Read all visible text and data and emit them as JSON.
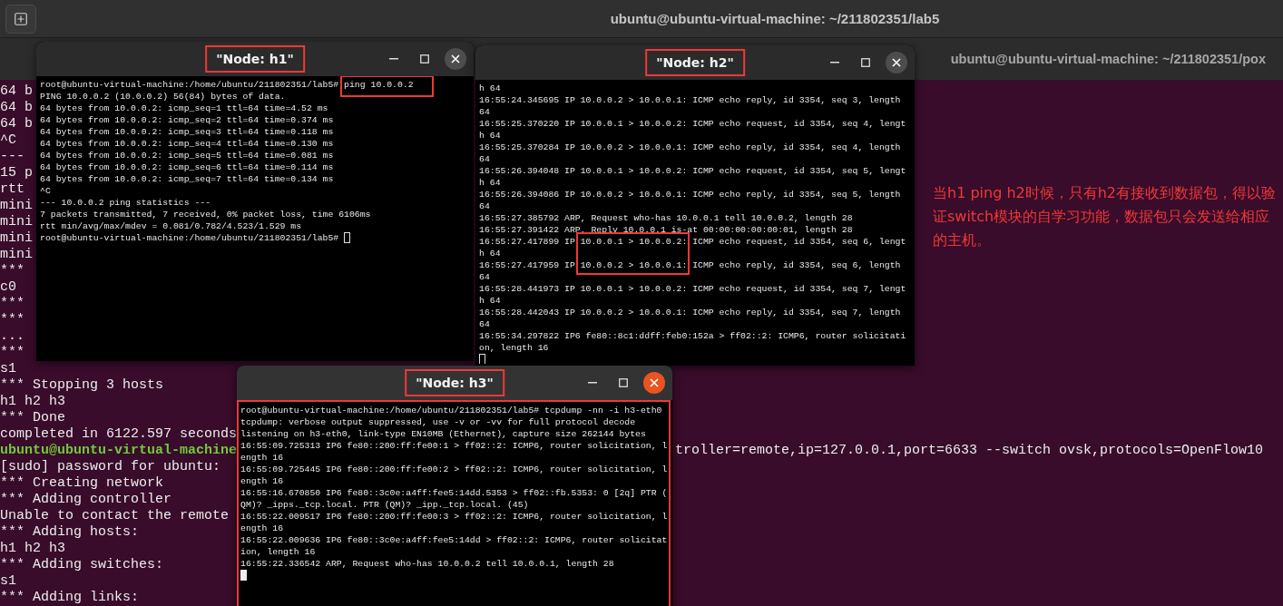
{
  "window": {
    "title": "ubuntu@ubuntu-virtual-machine: ~/211802351/lab5"
  },
  "tabs": [
    {
      "title": "ubuntu@ubuntu-virtual-machine: ~/211802351/pox"
    }
  ],
  "terminal": {
    "lines": [
      {
        "kind": "output",
        "text": "64 b"
      },
      {
        "kind": "output",
        "text": "64 b"
      },
      {
        "kind": "output",
        "text": "64 b"
      },
      {
        "kind": "output",
        "text": "^C"
      },
      {
        "kind": "output",
        "text": "---"
      },
      {
        "kind": "output",
        "text": "15 p"
      },
      {
        "kind": "output",
        "text": "rtt"
      },
      {
        "kind": "output",
        "text": "mini"
      },
      {
        "kind": "output",
        "text": "mini"
      },
      {
        "kind": "output",
        "text": "mini"
      },
      {
        "kind": "output",
        "text": "mini"
      },
      {
        "kind": "output",
        "text": "***"
      },
      {
        "kind": "output",
        "text": "c0"
      },
      {
        "kind": "output",
        "text": "***"
      },
      {
        "kind": "output",
        "text": "***"
      },
      {
        "kind": "output",
        "text": "..."
      },
      {
        "kind": "output",
        "text": "***"
      },
      {
        "kind": "output",
        "text": "s1"
      },
      {
        "kind": "output",
        "text": "*** Stopping 3 hosts"
      },
      {
        "kind": "output",
        "text": "h1 h2 h3"
      },
      {
        "kind": "output",
        "text": "*** Done"
      },
      {
        "kind": "output",
        "text": "completed in 6122.597 seconds"
      },
      {
        "kind": "prompt",
        "text": "ubuntu@ubuntu-virtual-machine",
        "tail": "troller=remote,ip=127.0.0.1,port=6633 --switch ovsk,protocols=OpenFlow10"
      },
      {
        "kind": "output",
        "text": "[sudo] password for ubuntu:"
      },
      {
        "kind": "output",
        "text": "*** Creating network"
      },
      {
        "kind": "output",
        "text": "*** Adding controller"
      },
      {
        "kind": "output",
        "text": "Unable to contact the remote"
      },
      {
        "kind": "output",
        "text": "*** Adding hosts:"
      },
      {
        "kind": "output",
        "text": "h1 h2 h3"
      },
      {
        "kind": "output",
        "text": "*** Adding switches:"
      },
      {
        "kind": "output",
        "text": "s1"
      },
      {
        "kind": "output",
        "text": "*** Adding links:"
      }
    ]
  },
  "annotation": {
    "text": "当h1 ping h2时候，只有h2有接收到数据包，得以验证switch模块的自学习功能，数据包只会发送给相应的主机。"
  },
  "nodes": [
    {
      "title": "\"Node: h1\"",
      "title_boxed": true,
      "focused": false,
      "outlined": false,
      "cursor_hollow": true,
      "cursor_on_new_line": false,
      "lines": [
        {
          "pre": "root@ubuntu-virtual-machine:/home/ubuntu/211802351/lab5# ",
          "mark": "ping 10.0.0.2",
          "boxed": true
        },
        "PING 10.0.0.2 (10.0.0.2) 56(84) bytes of data.",
        "64 bytes from 10.0.0.2: icmp_seq=1 ttl=64 time=4.52 ms",
        "64 bytes from 10.0.0.2: icmp_seq=2 ttl=64 time=0.374 ms",
        "64 bytes from 10.0.0.2: icmp_seq=3 ttl=64 time=0.118 ms",
        "64 bytes from 10.0.0.2: icmp_seq=4 ttl=64 time=0.130 ms",
        "64 bytes from 10.0.0.2: icmp_seq=5 ttl=64 time=0.081 ms",
        "64 bytes from 10.0.0.2: icmp_seq=6 ttl=64 time=0.114 ms",
        "64 bytes from 10.0.0.2: icmp_seq=7 ttl=64 time=0.134 ms",
        "^C",
        "--- 10.0.0.2 ping statistics ---",
        "7 packets transmitted, 7 received, 0% packet loss, time 6106ms",
        "rtt min/avg/max/mdev = 0.081/0.782/4.523/1.529 ms",
        "root@ubuntu-virtual-machine:/home/ubuntu/211802351/lab5#"
      ]
    },
    {
      "title": "\"Node: h2\"",
      "title_boxed": true,
      "focused": false,
      "outlined": false,
      "cursor_hollow": true,
      "cursor_on_new_line": true,
      "lines": [
        "h 64",
        "16:55:24.345695 IP 10.0.0.2 > 10.0.0.1: ICMP echo reply, id 3354, seq 3, length",
        "64",
        "16:55:25.370220 IP 10.0.0.1 > 10.0.0.2: ICMP echo request, id 3354, seq 4, lengt",
        "h 64",
        "16:55:25.370284 IP 10.0.0.2 > 10.0.0.1: ICMP echo reply, id 3354, seq 4, length",
        "64",
        "16:55:26.394048 IP 10.0.0.1 > 10.0.0.2: ICMP echo request, id 3354, seq 5, lengt",
        "h 64",
        "16:55:26.394086 IP 10.0.0.2 > 10.0.0.1: ICMP echo reply, id 3354, seq 5, length",
        "64",
        "16:55:27.385792 ARP, Request who-has 10.0.0.1 tell 10.0.0.2, length 28",
        "16:55:27.391422 ARP, Reply 10.0.0.1 is-at 00:00:00:00:00:01, length 28",
        {
          "pre": "16:55:27.417899 IP ",
          "mark": "10.0.0.1 > 10.0.0.2:",
          "post": " ICMP echo request, id 3354, seq 6, lengt",
          "boxed": true
        },
        "h 64",
        {
          "pre": "16:55:27.417959 IP ",
          "mark": "10.0.0.2 > 10.0.0.1:",
          "post": " ICMP echo reply, id 3354, seq 6, length",
          "boxed": true
        },
        "64",
        "16:55:28.441973 IP 10.0.0.1 > 10.0.0.2: ICMP echo request, id 3354, seq 7, lengt",
        "h 64",
        "16:55:28.442043 IP 10.0.0.2 > 10.0.0.1: ICMP echo reply, id 3354, seq 7, length",
        "64",
        "16:55:34.297822 IP6 fe80::8c1:ddff:feb0:152a > ff02::2: ICMP6, router solicitati",
        "on, length 16"
      ]
    },
    {
      "title": "\"Node: h3\"",
      "title_boxed": true,
      "focused": true,
      "outlined": true,
      "cursor_hollow": false,
      "cursor_on_new_line": true,
      "lines": [
        "root@ubuntu-virtual-machine:/home/ubuntu/211802351/lab5# tcpdump -nn -i h3-eth0",
        "tcpdump: verbose output suppressed, use -v or -vv for full protocol decode",
        "listening on h3-eth0, link-type EN10MB (Ethernet), capture size 262144 bytes",
        "16:55:09.725313 IP6 fe80::200:ff:fe00:1 > ff02::2: ICMP6, router solicitation, l",
        "ength 16",
        "16:55:09.725445 IP6 fe80::200:ff:fe00:2 > ff02::2: ICMP6, router solicitation, l",
        "ength 16",
        "16:55:16.670850 IP6 fe80::3c0e:a4ff:fee5:14dd.5353 > ff02::fb.5353: 0 [2q] PTR (",
        "QM)? _ipps._tcp.local. PTR (QM)? _ipp._tcp.local. (45)",
        "16:55:22.009517 IP6 fe80::200:ff:fe00:3 > ff02::2: ICMP6, router solicitation, l",
        "ength 16",
        "16:55:22.009636 IP6 fe80::3c0e:a4ff:fee5:14dd > ff02::2: ICMP6, router solicitat",
        "ion, length 16",
        "16:55:22.336542 ARP, Request who-has 10.0.0.2 tell 10.0.0.1, length 28"
      ]
    }
  ]
}
